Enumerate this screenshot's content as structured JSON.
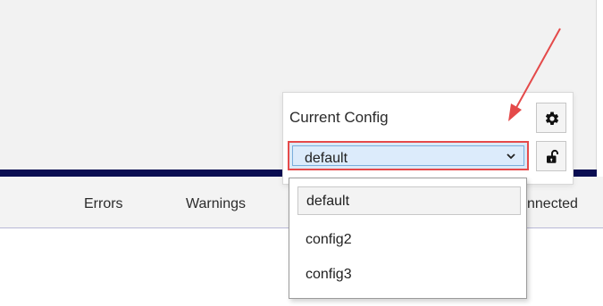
{
  "status_bar": {
    "errors": "Errors",
    "warnings": "Warnings",
    "connected": "nnected"
  },
  "config_panel": {
    "label": "Current Config",
    "selected_value": "default",
    "gear_icon": "gear-icon",
    "lock_icon": "unlock-icon",
    "dropdown_icon": "chevron-down-icon"
  },
  "dropdown": {
    "options": [
      "default",
      "config2",
      "config3"
    ],
    "selected_index": 0
  },
  "colors": {
    "accent_blue": "#0a0d52",
    "highlight_red": "#e64a4a",
    "select_fill": "#dcebfb"
  }
}
